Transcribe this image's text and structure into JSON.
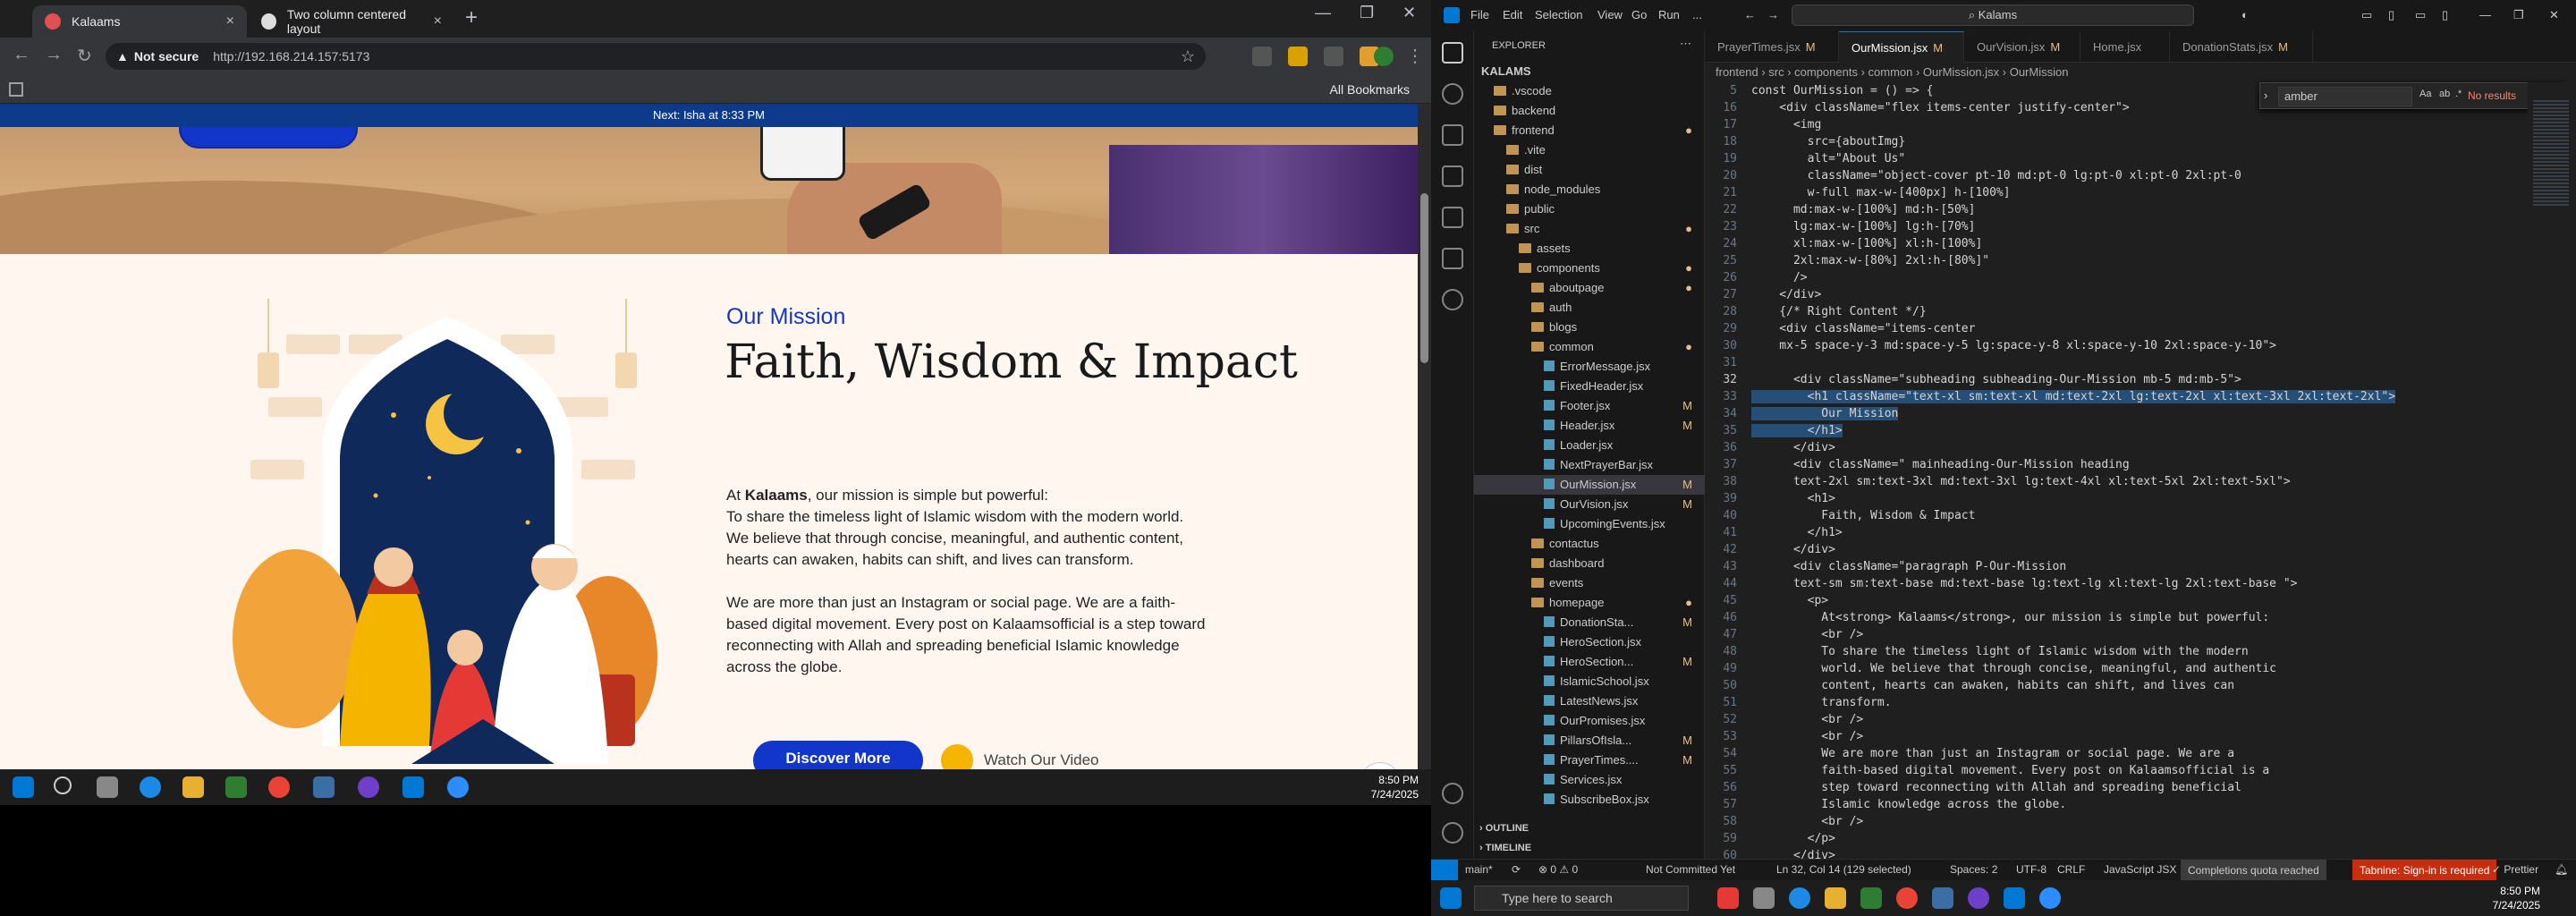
{
  "chrome": {
    "tabs": [
      {
        "title": "Kalaams",
        "active": true
      },
      {
        "title": "Two column centered layout",
        "active": false
      }
    ],
    "security_label": "Not secure",
    "url": "http://192.168.214.157:5173",
    "all_bookmarks": "All Bookmarks"
  },
  "site": {
    "prayer_banner": "Next: Isha at 8:33 PM",
    "mission": {
      "subheading": "Our Mission",
      "title": "Faith, Wisdom & Impact",
      "intro_prefix": "At ",
      "intro_brand": "Kalaams",
      "intro_suffix": ", our mission is simple but powerful:",
      "para1": "To share the timeless light of Islamic wisdom with the modern world. We believe that through concise, meaningful, and authentic content, hearts can awaken, habits can shift, and lives can transform.",
      "para2": "We are more than just an Instagram or social page. We are a faith-based digital movement. Every post on Kalaamsofficial is a step toward reconnecting with Allah and spreading beneficial Islamic knowledge across the globe.",
      "discover_btn": "Discover More",
      "watch_btn": "Watch Our Video"
    }
  },
  "left_taskbar": {
    "time": "8:50 PM",
    "date": "7/24/2025"
  },
  "vscode": {
    "menu": [
      "File",
      "Edit",
      "Selection",
      "View",
      "Go",
      "Run",
      "..."
    ],
    "command_center": "Kalams",
    "explorer_title": "EXPLORER",
    "tree": [
      {
        "label": "KALAMS",
        "depth": 0,
        "type": "root",
        "badge": ""
      },
      {
        "label": ".vscode",
        "depth": 1,
        "type": "folder",
        "badge": ""
      },
      {
        "label": "backend",
        "depth": 1,
        "type": "folder",
        "badge": ""
      },
      {
        "label": "frontend",
        "depth": 1,
        "type": "folder",
        "badge": "●"
      },
      {
        "label": ".vite",
        "depth": 2,
        "type": "folder",
        "badge": ""
      },
      {
        "label": "dist",
        "depth": 2,
        "type": "folder",
        "badge": ""
      },
      {
        "label": "node_modules",
        "depth": 2,
        "type": "folder",
        "badge": ""
      },
      {
        "label": "public",
        "depth": 2,
        "type": "folder",
        "badge": ""
      },
      {
        "label": "src",
        "depth": 2,
        "type": "folder",
        "badge": "●"
      },
      {
        "label": "assets",
        "depth": 3,
        "type": "folder",
        "badge": ""
      },
      {
        "label": "components",
        "depth": 3,
        "type": "folder",
        "badge": "●"
      },
      {
        "label": "aboutpage",
        "depth": 4,
        "type": "folder",
        "badge": "●"
      },
      {
        "label": "auth",
        "depth": 4,
        "type": "folder",
        "badge": ""
      },
      {
        "label": "blogs",
        "depth": 4,
        "type": "folder",
        "badge": ""
      },
      {
        "label": "common",
        "depth": 4,
        "type": "folder",
        "badge": "●"
      },
      {
        "label": "ErrorMessage.jsx",
        "depth": 5,
        "type": "file",
        "badge": ""
      },
      {
        "label": "FixedHeader.jsx",
        "depth": 5,
        "type": "file",
        "badge": ""
      },
      {
        "label": "Footer.jsx",
        "depth": 5,
        "type": "file",
        "badge": "M"
      },
      {
        "label": "Header.jsx",
        "depth": 5,
        "type": "file",
        "badge": "M"
      },
      {
        "label": "Loader.jsx",
        "depth": 5,
        "type": "file",
        "badge": ""
      },
      {
        "label": "NextPrayerBar.jsx",
        "depth": 5,
        "type": "file",
        "badge": ""
      },
      {
        "label": "OurMission.jsx",
        "depth": 5,
        "type": "file",
        "badge": "M",
        "selected": true
      },
      {
        "label": "OurVision.jsx",
        "depth": 5,
        "type": "file",
        "badge": "M"
      },
      {
        "label": "UpcomingEvents.jsx",
        "depth": 5,
        "type": "file",
        "badge": ""
      },
      {
        "label": "contactus",
        "depth": 4,
        "type": "folder",
        "badge": ""
      },
      {
        "label": "dashboard",
        "depth": 4,
        "type": "folder",
        "badge": ""
      },
      {
        "label": "events",
        "depth": 4,
        "type": "folder",
        "badge": ""
      },
      {
        "label": "homepage",
        "depth": 4,
        "type": "folder",
        "badge": "●"
      },
      {
        "label": "DonationSta...",
        "depth": 5,
        "type": "file",
        "badge": "M"
      },
      {
        "label": "HeroSection.jsx",
        "depth": 5,
        "type": "file",
        "badge": ""
      },
      {
        "label": "HeroSection...",
        "depth": 5,
        "type": "file",
        "badge": "M"
      },
      {
        "label": "IslamicSchool.jsx",
        "depth": 5,
        "type": "file",
        "badge": ""
      },
      {
        "label": "LatestNews.jsx",
        "depth": 5,
        "type": "file",
        "badge": ""
      },
      {
        "label": "OurPromises.jsx",
        "depth": 5,
        "type": "file",
        "badge": ""
      },
      {
        "label": "PillarsOfIsla...",
        "depth": 5,
        "type": "file",
        "badge": "M"
      },
      {
        "label": "PrayerTimes....",
        "depth": 5,
        "type": "file",
        "badge": "M"
      },
      {
        "label": "Services.jsx",
        "depth": 5,
        "type": "file",
        "badge": ""
      },
      {
        "label": "SubscribeBox.jsx",
        "depth": 5,
        "type": "file",
        "badge": ""
      }
    ],
    "outline": "OUTLINE",
    "timeline": "TIMELINE",
    "editor_tabs": [
      {
        "label": "PrayerTimes.jsx",
        "badge": "M",
        "active": false
      },
      {
        "label": "OurMission.jsx",
        "badge": "M",
        "active": true
      },
      {
        "label": "OurVision.jsx",
        "badge": "M",
        "active": false
      },
      {
        "label": "Home.jsx",
        "badge": "",
        "active": false
      },
      {
        "label": "DonationStats.jsx",
        "badge": "M",
        "active": false
      }
    ],
    "breadcrumb": "frontend › src › components › common › OurMission.jsx › OurMission",
    "find": {
      "query": "amber",
      "result": "No results"
    },
    "code_lines": [
      {
        "n": "5",
        "t": "const OurMission = () => {"
      },
      {
        "n": "16",
        "t": "    <div className=\"flex items-center justify-center\">"
      },
      {
        "n": "17",
        "t": "      <img"
      },
      {
        "n": "18",
        "t": "        src={aboutImg}"
      },
      {
        "n": "19",
        "t": "        alt=\"About Us\""
      },
      {
        "n": "20",
        "t": "        className=\"object-cover pt-10 md:pt-0 lg:pt-0 xl:pt-0 2xl:pt-0"
      },
      {
        "n": "21",
        "t": "        w-full max-w-[400px] h-[100%]"
      },
      {
        "n": "22",
        "t": "      md:max-w-[100%] md:h-[50%]"
      },
      {
        "n": "23",
        "t": "      lg:max-w-[100%] lg:h-[70%]"
      },
      {
        "n": "24",
        "t": "      xl:max-w-[100%] xl:h-[100%]"
      },
      {
        "n": "25",
        "t": "      2xl:max-w-[80%] 2xl:h-[80%]\""
      },
      {
        "n": "26",
        "t": "      />"
      },
      {
        "n": "27",
        "t": "    </div>"
      },
      {
        "n": "28",
        "t": "    {/* Right Content */}"
      },
      {
        "n": "29",
        "t": "    <div className=\"items-center"
      },
      {
        "n": "30",
        "t": "    mx-5 space-y-3 md:space-y-5 lg:space-y-8 xl:space-y-10 2xl:space-y-10\">"
      },
      {
        "n": "31",
        "t": ""
      },
      {
        "n": "32",
        "t": "      <div className=\"subheading subheading-Our-Mission mb-5 md:mb-5\">"
      },
      {
        "n": "33",
        "t": "        <h1 className=\"text-xl sm:text-xl md:text-2xl lg:text-2xl xl:text-3xl 2xl:text-2xl\">",
        "sel": true
      },
      {
        "n": "34",
        "t": "          Our Mission",
        "sel": true
      },
      {
        "n": "35",
        "t": "        </h1>",
        "sel": true
      },
      {
        "n": "36",
        "t": "      </div>"
      },
      {
        "n": "37",
        "t": "      <div className=\" mainheading-Our-Mission heading"
      },
      {
        "n": "38",
        "t": "      text-2xl sm:text-3xl md:text-3xl lg:text-4xl xl:text-5xl 2xl:text-5xl\">"
      },
      {
        "n": "39",
        "t": "        <h1>"
      },
      {
        "n": "40",
        "t": "          Faith, Wisdom & Impact"
      },
      {
        "n": "41",
        "t": "        </h1>"
      },
      {
        "n": "42",
        "t": "      </div>"
      },
      {
        "n": "43",
        "t": "      <div className=\"paragraph P-Our-Mission"
      },
      {
        "n": "44",
        "t": "      text-sm sm:text-base md:text-base lg:text-lg xl:text-lg 2xl:text-base \">"
      },
      {
        "n": "45",
        "t": "        <p>"
      },
      {
        "n": "46",
        "t": "          At<strong> Kalaams</strong>, our mission is simple but powerful:"
      },
      {
        "n": "47",
        "t": "          <br />"
      },
      {
        "n": "48",
        "t": "          To share the timeless light of Islamic wisdom with the modern"
      },
      {
        "n": "49",
        "t": "          world. We believe that through concise, meaningful, and authentic"
      },
      {
        "n": "50",
        "t": "          content, hearts can awaken, habits can shift, and lives can"
      },
      {
        "n": "51",
        "t": "          transform."
      },
      {
        "n": "52",
        "t": "          <br />"
      },
      {
        "n": "53",
        "t": "          <br />"
      },
      {
        "n": "54",
        "t": "          We are more than just an Instagram or social page. We are a"
      },
      {
        "n": "55",
        "t": "          faith-based digital movement. Every post on Kalaamsofficial is a"
      },
      {
        "n": "56",
        "t": "          step toward reconnecting with Allah and spreading beneficial"
      },
      {
        "n": "57",
        "t": "          Islamic knowledge across the globe."
      },
      {
        "n": "58",
        "t": "          <br />"
      },
      {
        "n": "59",
        "t": "        </p>"
      },
      {
        "n": "60",
        "t": "      </div>"
      }
    ],
    "status": {
      "branch": "main*",
      "sync": "⟳",
      "problems": "⊗ 0 ⚠ 0",
      "commit": "Not Committed Yet",
      "cursor": "Ln 32, Col 14 (129 selected)",
      "spaces": "Spaces: 2",
      "encoding": "UTF-8",
      "eol": "CRLF",
      "language": "JavaScript JSX",
      "quota": "Completions quota reached",
      "tabnine": "Tabnine: Sign-in is required",
      "prettier": "✓ Prettier"
    }
  },
  "right_taskbar": {
    "search_placeholder": "Type here to search",
    "time": "8:50 PM",
    "date": "7/24/2025"
  },
  "colors": {
    "brand_blue": "#1236c9",
    "vscode_accent": "#0078d4",
    "modified": "#e2c08d"
  }
}
